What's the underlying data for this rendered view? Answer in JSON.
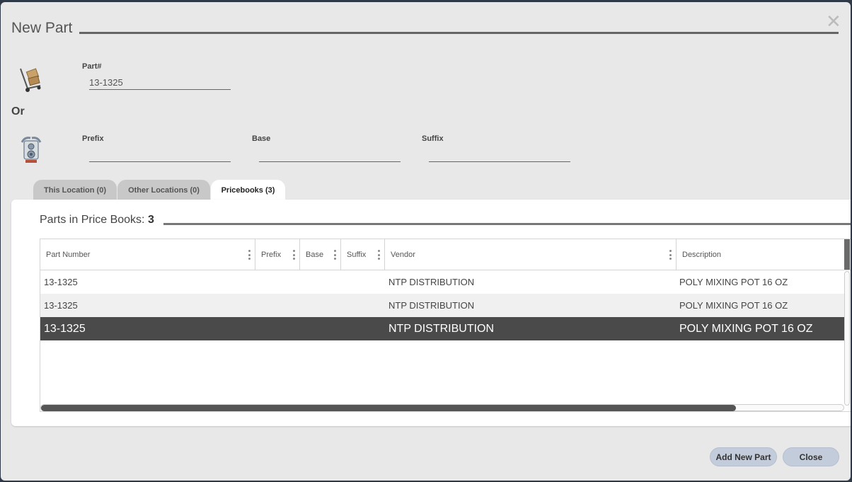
{
  "dialog": {
    "title": "New Part",
    "close_symbol": "✕"
  },
  "part_number": {
    "label": "Part#",
    "value": "13-1325",
    "icon": "hand-truck-boxes-icon"
  },
  "or_label": "Or",
  "split_fields": {
    "icon": "brake-rotor-parts-icon",
    "prefix": {
      "label": "Prefix",
      "value": ""
    },
    "base": {
      "label": "Base",
      "value": ""
    },
    "suffix": {
      "label": "Suffix",
      "value": ""
    }
  },
  "tabs": [
    {
      "label": "This Location (0)",
      "active": false
    },
    {
      "label": "Other Locations (0)",
      "active": false
    },
    {
      "label": "Pricebooks (3)",
      "active": true
    }
  ],
  "pricebooks": {
    "title_prefix": "Parts in Price Books:",
    "count": "3",
    "columns": [
      "Part Number",
      "Prefix",
      "Base",
      "Suffix",
      "Vendor",
      "Description"
    ],
    "rows": [
      {
        "part_number": "13-1325",
        "prefix": "",
        "base": "",
        "suffix": "",
        "vendor": "NTP DISTRIBUTION",
        "description": "POLY MIXING POT 16 OZ",
        "selected": false
      },
      {
        "part_number": "13-1325",
        "prefix": "",
        "base": "",
        "suffix": "",
        "vendor": "NTP DISTRIBUTION",
        "description": "POLY MIXING POT 16 OZ",
        "selected": false
      },
      {
        "part_number": "13-1325",
        "prefix": "",
        "base": "",
        "suffix": "",
        "vendor": "NTP DISTRIBUTION",
        "description": "POLY MIXING POT 16 OZ",
        "selected": true
      }
    ]
  },
  "buttons": {
    "add_new_part": "Add New Part",
    "close": "Close"
  },
  "colors": {
    "selected_row": "#4a4a4a",
    "button_bg": "#c3ccdb"
  }
}
